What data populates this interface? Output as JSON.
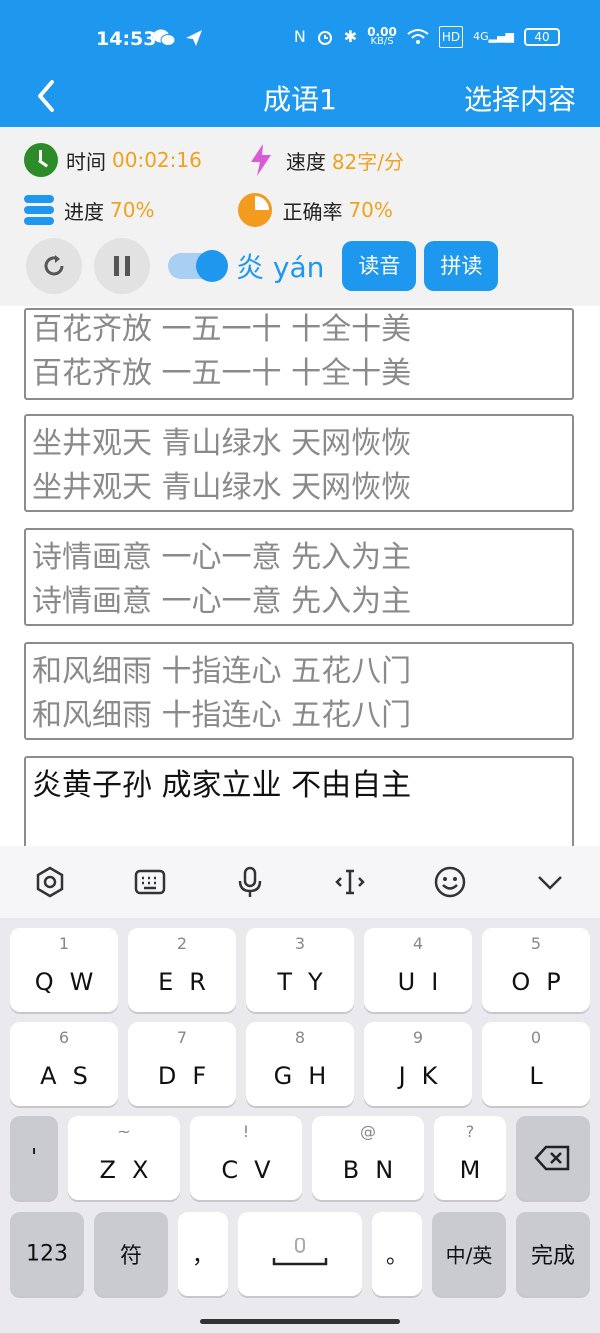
{
  "status": {
    "time": "14:53",
    "net_speed_value": "0.00",
    "net_speed_unit": "KB/S",
    "hd": "HD",
    "signal": "4G",
    "battery": "40"
  },
  "appbar": {
    "title": "成语1",
    "action": "选择内容"
  },
  "stats": {
    "time_label": "时间",
    "time_value": "00:02:16",
    "speed_label": "速度",
    "speed_value": "82字/分",
    "progress_label": "进度",
    "progress_value": "70%",
    "accuracy_label": "正确率",
    "accuracy_value": "70%"
  },
  "controls": {
    "toggle_on": true,
    "current_char": "炎 yán",
    "read_label": "读音",
    "pinyin_label": "拼读"
  },
  "boxes": [
    {
      "line1": "百花齐放 一五一十 十全十美",
      "line2": "百花齐放 一五一十 十全十美"
    },
    {
      "line1": "坐井观天 青山绿水 天网恢恢",
      "line2": "坐井观天 青山绿水 天网恢恢"
    },
    {
      "line1": "诗情画意 一心一意 先入为主",
      "line2": "诗情画意 一心一意 先入为主"
    },
    {
      "line1": "和风细雨 十指连心 五花八门",
      "line2": "和风细雨 十指连心 五花八门"
    },
    {
      "line1": "炎黄子孙 成家立业 不由自主",
      "line2": ""
    }
  ],
  "keyboard": {
    "row1": [
      {
        "num": "1",
        "label": "QW"
      },
      {
        "num": "2",
        "label": "ER"
      },
      {
        "num": "3",
        "label": "TY"
      },
      {
        "num": "4",
        "label": "UI"
      },
      {
        "num": "5",
        "label": "OP"
      }
    ],
    "row2": [
      {
        "num": "6",
        "label": "AS"
      },
      {
        "num": "7",
        "label": "DF"
      },
      {
        "num": "8",
        "label": "GH"
      },
      {
        "num": "9",
        "label": "JK"
      },
      {
        "num": "0",
        "label": "L"
      }
    ],
    "row3": [
      {
        "num": "",
        "label": "'"
      },
      {
        "num": "~",
        "label": "ZX"
      },
      {
        "num": "!",
        "label": "CV"
      },
      {
        "num": "@",
        "label": "BN"
      },
      {
        "num": "?",
        "label": "M"
      }
    ],
    "bottom": {
      "k123": "123",
      "symbols": "符",
      "comma": "，",
      "period": "。",
      "lang": "中/英",
      "done": "完成"
    }
  }
}
